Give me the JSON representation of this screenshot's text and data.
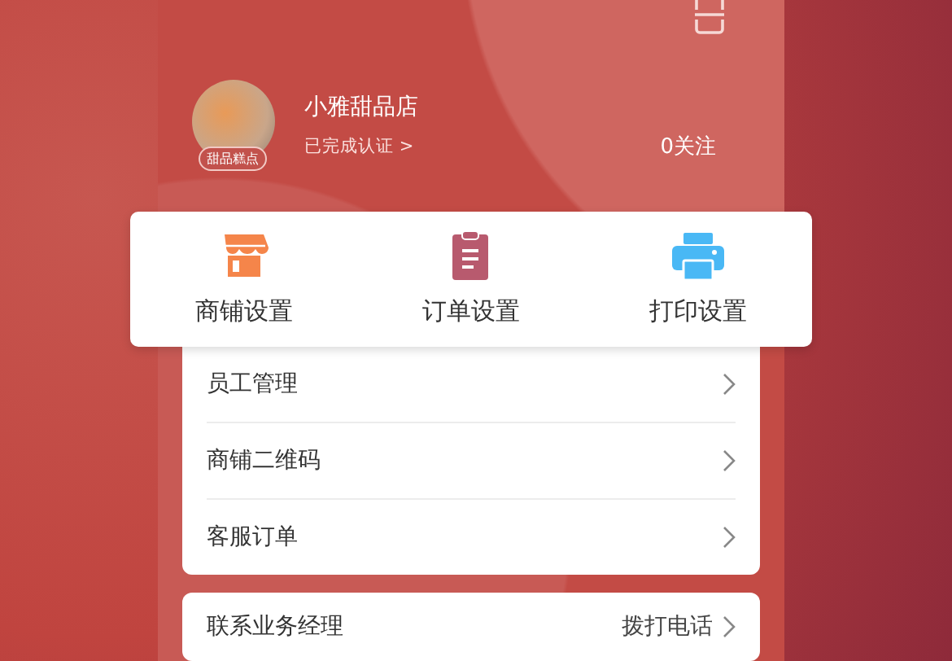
{
  "shop": {
    "name": "小雅甜品店",
    "category": "甜品糕点",
    "verification": "已完成认证 >",
    "follows": "0关注"
  },
  "shortcuts": [
    {
      "label": "商铺设置",
      "kind": "store"
    },
    {
      "label": "订单设置",
      "kind": "clipboard"
    },
    {
      "label": "打印设置",
      "kind": "printer"
    }
  ],
  "menu": [
    {
      "label": "员工管理"
    },
    {
      "label": "商铺二维码"
    },
    {
      "label": "客服订单"
    }
  ],
  "contact": {
    "label": "联系业务经理",
    "action": "拨打电话"
  }
}
